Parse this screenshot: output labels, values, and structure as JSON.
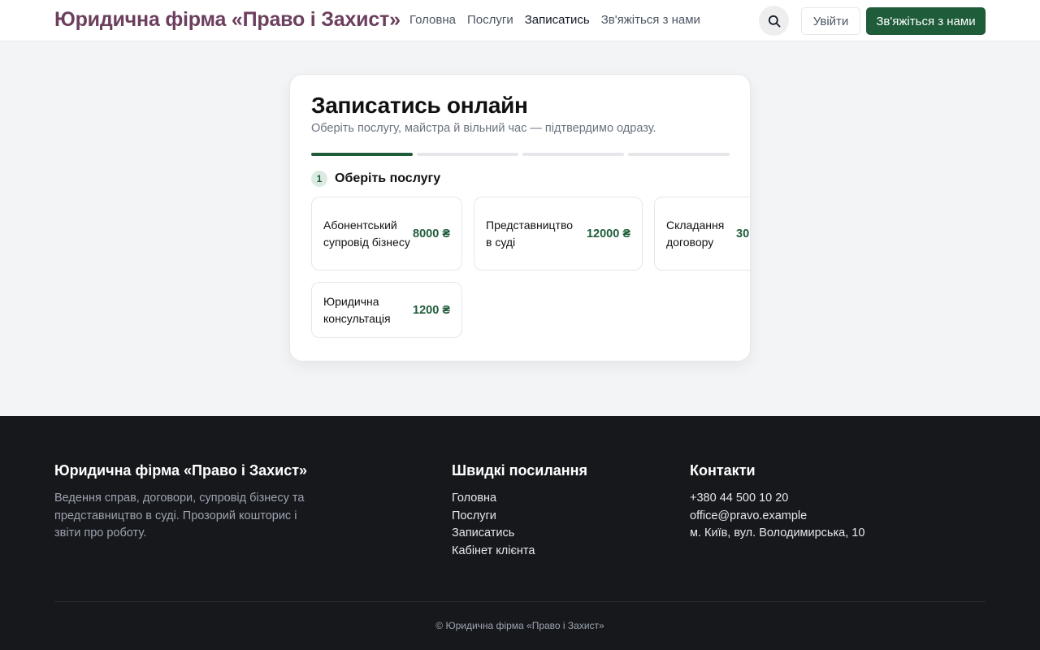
{
  "header": {
    "brand": "Юридична фірма «Право і Захист»",
    "nav": [
      "Головна",
      "Послуги",
      "Записатись",
      "Зв'яжіться з нами"
    ],
    "active_nav": "Записатись",
    "login_label": "Увійти",
    "contact_label": "Зв'яжіться з нами",
    "search_icon": "search-icon"
  },
  "booking": {
    "title": "Записатись онлайн",
    "subtitle": "Оберіть послугу, майстра й вільний час — підтвердимо одразу.",
    "progress_total_steps": 4,
    "progress_current_step": 1,
    "step_number": "1",
    "step_label": "Оберіть послугу",
    "services": [
      {
        "name": "Абонентський супровід бізнесу",
        "price": "8000 ₴"
      },
      {
        "name": "Представництво в суді",
        "price": "12000 ₴"
      },
      {
        "name": "Складання договору",
        "price": "30"
      },
      {
        "name": "Юридична консультація",
        "price": "1200 ₴"
      }
    ]
  },
  "footer": {
    "brand": "Юридична фірма «Право і Захист»",
    "description": "Ведення справ, договори, супровід бізнесу та представництво в суді. Прозорий кошторис і звіти про роботу.",
    "links_title": "Швидкі посилання",
    "links": [
      "Головна",
      "Послуги",
      "Записатись",
      "Кабінет клієнта"
    ],
    "contacts_title": "Контакти",
    "phone": "+380 44 500 10 20",
    "email": "office@pravo.example",
    "address": "м. Київ, вул. Володимирська, 10",
    "copyright": "© Юридична фірма «Право і Захист»"
  },
  "colors": {
    "brand": "#6b3f5d",
    "accent": "#1f5c3a",
    "footer_bg": "#17181c"
  }
}
